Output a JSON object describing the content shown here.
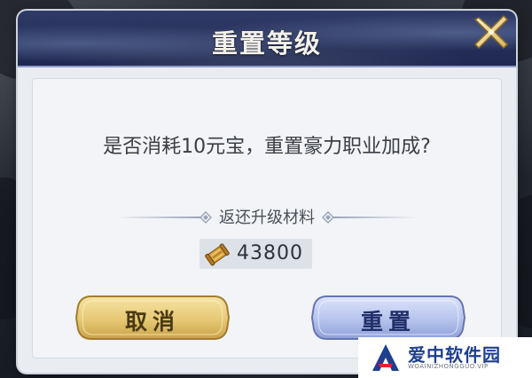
{
  "dialog": {
    "title": "重置等级",
    "question": "是否消耗10元宝，重置豪力职业加成?",
    "refund_label": "返还升级材料",
    "material": {
      "icon": "scroll-icon",
      "count": "43800"
    },
    "buttons": {
      "cancel_label": "取消",
      "confirm_label": "重置"
    },
    "close_icon": "close-icon"
  },
  "watermark": {
    "name": "爱中软件园",
    "url": "WOAINIZHONGGUO.VIP"
  },
  "colors": {
    "header_bg": "#25305a",
    "panel_bg": "#f2f4f7",
    "cancel_button": "#e8cf86",
    "confirm_button": "#b6c3ec",
    "text_dark": "#3a3d45"
  }
}
